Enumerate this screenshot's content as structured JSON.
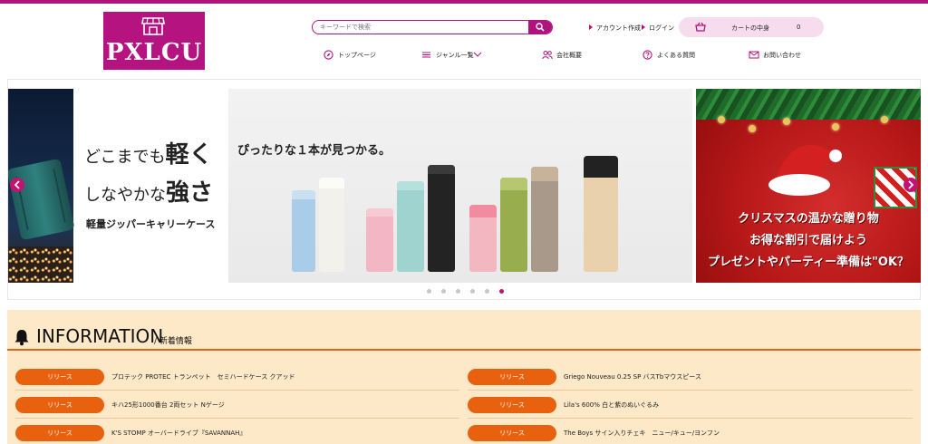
{
  "brand": {
    "logo_text": "PXLCU",
    "accent": "#b0127e",
    "info_accent": "#e8610e"
  },
  "search": {
    "placeholder": "キーワードで検索"
  },
  "account_links": {
    "create": "アカウント作成",
    "login": "ログイン"
  },
  "cart": {
    "label": "カートの中身",
    "count": "0"
  },
  "global_nav": [
    {
      "label": "トップページ",
      "icon": "compass-icon"
    },
    {
      "label": "ジャンル一覧",
      "icon": "menu-icon"
    },
    {
      "label": "会社概要",
      "icon": "people-icon"
    },
    {
      "label": "よくある質問",
      "icon": "question-icon"
    },
    {
      "label": "お問い合わせ",
      "icon": "mail-icon"
    }
  ],
  "slider": {
    "left": {
      "line1_prefix": "どこまでも",
      "line1_big": "軽く",
      "line2_prefix": "しなやかな",
      "line2_big": "強さ",
      "line3": "軽量ジッパーキャリーケース"
    },
    "center": {
      "caption": "ぴったりな１本が見つかる。"
    },
    "right": {
      "line1": "クリスマスの温かな贈り物",
      "line2": "お得な割引で届けよう",
      "line3": "プレゼントやパーティー準備は\"OK？"
    },
    "dots_count": 6,
    "active_dot": 6
  },
  "information": {
    "title": "INFORMATION",
    "subtitle": "/ 新着情報",
    "items": [
      {
        "badge": "リリース",
        "title": "プロテック PROTEC トランペット　セミハードケース クアッド"
      },
      {
        "badge": "リリース",
        "title": "Griego Nouveau 0.25 SP バスTbマウスピース"
      },
      {
        "badge": "リリース",
        "title": "キハ25形1000番台 2両セット Nゲージ"
      },
      {
        "badge": "リリース",
        "title": "Lila's 600% 白と紫のぬいぐるみ"
      },
      {
        "badge": "リリース",
        "title": "K'S STOMP オーバードライブ『SAVANNAH』"
      },
      {
        "badge": "リリース",
        "title": "The Boys サイン入りチェキ　ニュー/キュー/ヨンフン"
      }
    ]
  }
}
